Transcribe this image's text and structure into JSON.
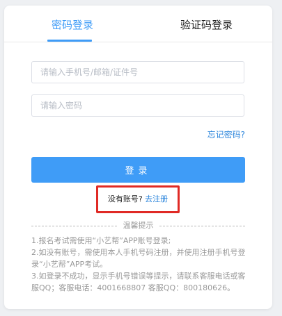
{
  "tabs": {
    "password_login": "密码登录",
    "code_login": "验证码登录"
  },
  "form": {
    "account_placeholder": "请输入手机号/邮箱/证件号",
    "password_placeholder": "请输入密码",
    "forgot_password": "忘记密码?",
    "login_button": "登录"
  },
  "register": {
    "question": "没有账号?",
    "link": "去注册"
  },
  "tips": {
    "title": "温馨提示",
    "lines": [
      "1.报名考试需使用“小艺帮”APP账号登录;",
      "2.如没有账号，需使用本人手机号码注册，并使用注册手机号登录“小艺帮”APP考试。",
      "3.如登录不成功，显示手机号错误等提示，请联系客服电话或客服QQ；客服电话：4001668807 客服QQ：800180626。"
    ]
  },
  "colors": {
    "accent": "#3f9cf7",
    "link": "#2d86dc",
    "highlight_border": "#e02a25"
  }
}
